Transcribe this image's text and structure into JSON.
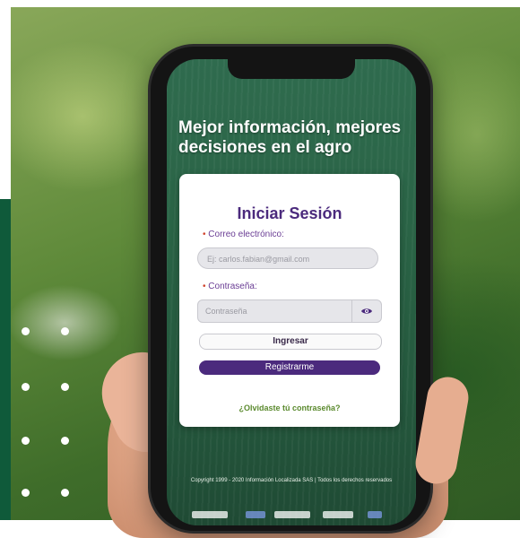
{
  "app": {
    "headline": "Mejor información, mejores decisiones en el agro",
    "login_card": {
      "title": "Iniciar Sesión",
      "email_label": "Correo electrónico:",
      "email_placeholder": "Ej: carlos.fabian@gmail.com",
      "password_label": "Contraseña:",
      "password_placeholder": "Contraseña",
      "required_mark": "•",
      "login_button": "Ingresar",
      "register_button": "Registrarme",
      "forgot_link": "¿Olvidaste tú contraseña?"
    },
    "footer": "Copyright 1999 - 2020 Información Localizada SAS | Todos los derechos reservados",
    "icons": {
      "password_toggle": "eye-icon"
    }
  },
  "colors": {
    "brand_purple": "#4b2a7d",
    "brand_green": "#0f5a3a",
    "link_green": "#5b8a2e"
  }
}
